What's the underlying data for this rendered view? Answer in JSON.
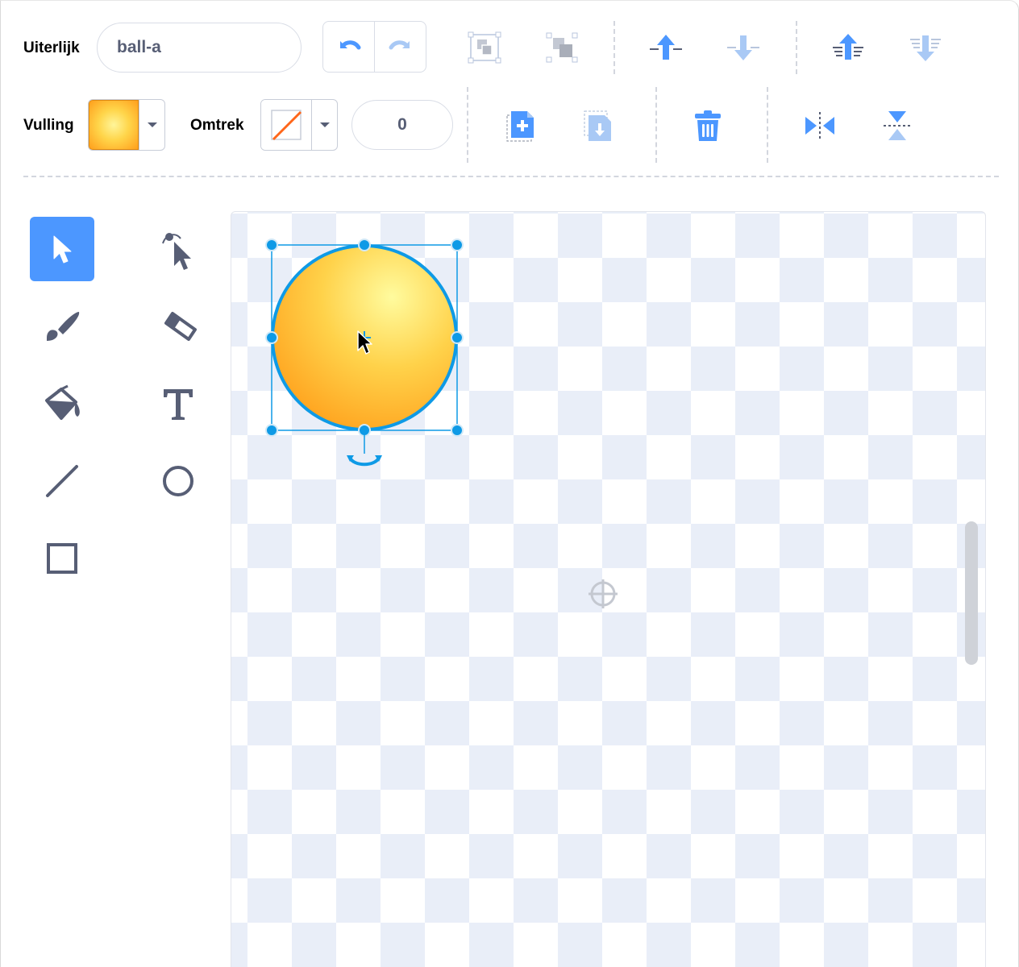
{
  "costume": {
    "label": "Uiterlijk",
    "name": "ball-a"
  },
  "fill": {
    "label": "Vulling",
    "color_center": "#fff59a",
    "color_edge": "#ff9f1c"
  },
  "outline": {
    "label": "Omtrek",
    "width": "0"
  },
  "toolbar": {
    "undo_icon": "undo-icon",
    "redo_icon": "redo-icon",
    "group_icon": "group-icon",
    "ungroup_icon": "ungroup-icon",
    "forward_icon": "forward-icon",
    "backward_icon": "backward-icon",
    "front_icon": "front-icon",
    "back_icon": "back-icon",
    "copy_icon": "copy-icon",
    "paste_icon": "paste-icon",
    "delete_icon": "delete-icon",
    "flip_h_icon": "flip-horizontal-icon",
    "flip_v_icon": "flip-vertical-icon"
  },
  "tools": [
    {
      "name": "select",
      "icon": "arrow-icon",
      "active": true
    },
    {
      "name": "reshape",
      "icon": "reshape-icon",
      "active": false
    },
    {
      "name": "brush",
      "icon": "brush-icon",
      "active": false
    },
    {
      "name": "eraser",
      "icon": "eraser-icon",
      "active": false
    },
    {
      "name": "fill",
      "icon": "bucket-icon",
      "active": false
    },
    {
      "name": "text",
      "icon": "text-icon",
      "active": false
    },
    {
      "name": "line",
      "icon": "line-icon",
      "active": false
    },
    {
      "name": "circle",
      "icon": "circle-icon",
      "active": false
    },
    {
      "name": "rectangle",
      "icon": "rectangle-icon",
      "active": false
    }
  ],
  "colors": {
    "accent": "#4c97ff",
    "selection": "#0e9ae6",
    "text": "#575e75"
  }
}
